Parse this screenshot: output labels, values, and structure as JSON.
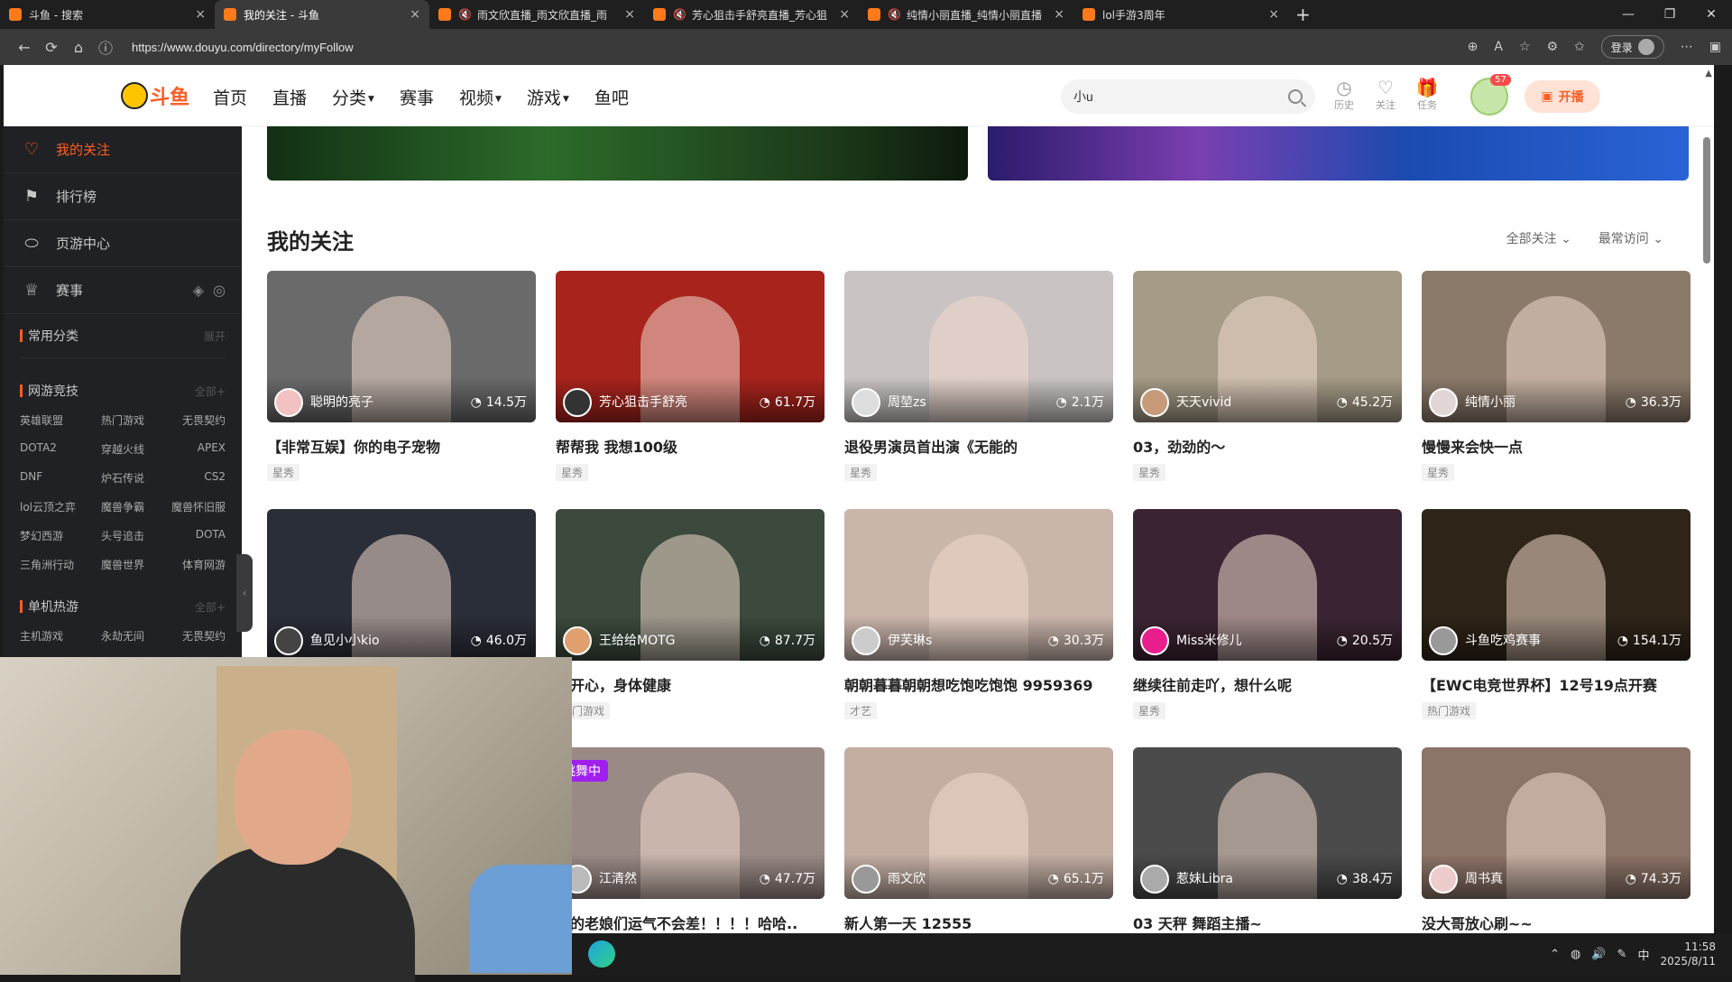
{
  "browser": {
    "tabs": [
      {
        "title": "斗鱼 - 搜索",
        "muted": false,
        "active": false
      },
      {
        "title": "我的关注 - 斗鱼",
        "muted": false,
        "active": true
      },
      {
        "title": "雨文欣直播_雨文欣直播_雨",
        "muted": true,
        "active": false
      },
      {
        "title": "芳心狙击手舒亮直播_芳心狙",
        "muted": true,
        "active": false
      },
      {
        "title": "纯情小丽直播_纯情小丽直播",
        "muted": true,
        "active": false
      },
      {
        "title": "lol手游3周年",
        "muted": false,
        "active": false
      }
    ],
    "url": "https://www.douyu.com/directory/myFollow",
    "login_label": "登录"
  },
  "header": {
    "logo_text": "斗鱼",
    "nav": [
      "首页",
      "直播",
      "分类",
      "赛事",
      "视频",
      "游戏",
      "鱼吧"
    ],
    "nav_dropdown": [
      false,
      false,
      true,
      false,
      true,
      true,
      false
    ],
    "search_value": "小u",
    "icons": [
      {
        "label": "历史",
        "glyph": "◷"
      },
      {
        "label": "关注",
        "glyph": "♡"
      },
      {
        "label": "任务",
        "glyph": "🎁"
      }
    ],
    "avatar_badge": "57",
    "kaibo_label": "开播"
  },
  "sidebar": {
    "items": [
      {
        "label": "我的关注",
        "icon": "heart-icon",
        "active": true
      },
      {
        "label": "排行榜",
        "icon": "rank-icon",
        "active": false
      },
      {
        "label": "页游中心",
        "icon": "mouse-icon",
        "active": false
      },
      {
        "label": "赛事",
        "icon": "trophy-icon",
        "active": false
      }
    ],
    "common": {
      "title": "常用分类",
      "more": "展开"
    },
    "wangyou": {
      "title": "网游竞技",
      "more": "全部",
      "items": [
        "英雄联盟",
        "热门游戏",
        "无畏契约",
        "DOTA2",
        "穿越火线",
        "APEX",
        "DNF",
        "炉石传说",
        "CS2",
        "lol云顶之弈",
        "魔兽争霸",
        "魔兽怀旧服",
        "梦幻西游",
        "头号追击",
        "DOTA",
        "三角洲行动",
        "魔兽世界",
        "体育网游"
      ]
    },
    "danji": {
      "title": "单机热游",
      "more": "全部",
      "items": [
        "主机游戏",
        "永劫无间",
        "无畏契约"
      ]
    }
  },
  "content": {
    "section_title": "我的关注",
    "filters": [
      "全部关注",
      "最常访问"
    ],
    "cards": [
      {
        "nick": "聪明的亮子",
        "heat": "14.5万",
        "title": "【非常互娱】你的电子宠物",
        "cat": "星秀",
        "bg": "#6a6a6a",
        "av": "#f2c1c1"
      },
      {
        "nick": "芳心狙击手舒亮",
        "heat": "61.7万",
        "title": "帮帮我 我想100级",
        "cat": "星秀",
        "bg": "#a8231c",
        "av": "#333"
      },
      {
        "nick": "周堃zs",
        "heat": "2.1万",
        "title": "退役男演员首出演《无能的",
        "cat": "星秀",
        "bg": "#c9c3c3",
        "av": "#ddd"
      },
      {
        "nick": "天天vivid",
        "heat": "45.2万",
        "title": "03，劲劲的～",
        "cat": "星秀",
        "bg": "#a59b86",
        "av": "#c79a7a"
      },
      {
        "nick": "纯情小丽",
        "heat": "36.3万",
        "title": "慢慢来会快一点",
        "cat": "星秀",
        "bg": "#8b7a6a",
        "av": "#e3d6d6"
      },
      {
        "nick": "鱼见小小kio",
        "heat": "46.0万",
        "title": "",
        "cat": "",
        "bg": "#2a2e38",
        "av": "#444"
      },
      {
        "nick": "王给给MOTG",
        "heat": "87.7万",
        "title": "天开心，身体健康",
        "cat": "热门游戏",
        "bg": "#3b4a3c",
        "av": "#e0a070"
      },
      {
        "nick": "伊芙琳s",
        "heat": "30.3万",
        "title": "朝朝暮暮朝朝想吃饱吃饱饱 9959369",
        "cat": "才艺",
        "bg": "#c9b5aa",
        "av": "#ccc"
      },
      {
        "nick": "Miss米修儿",
        "heat": "20.5万",
        "title": "继续往前走吖，想什么呢",
        "cat": "星秀",
        "bg": "#3a2433",
        "av": "#e91e8c"
      },
      {
        "nick": "斗鱼吃鸡赛事",
        "heat": "154.1万",
        "title": "【EWC电竞世界杯】12号19点开赛",
        "cat": "热门游戏",
        "bg": "#2e2418",
        "av": "#999"
      },
      {
        "nick": "",
        "heat": "",
        "title": "",
        "cat": "",
        "bg": "#555",
        "av": "#555"
      },
      {
        "nick": "江清然",
        "heat": "47.7万",
        "title": "笑的老娘们运气不会差！！！！哈哈..",
        "cat": "",
        "bg": "#9a8a86",
        "av": "#bbb",
        "tag": "跳舞中"
      },
      {
        "nick": "雨文欣",
        "heat": "65.1万",
        "title": "新人第一天 12555",
        "cat": "",
        "bg": "#c4aea2",
        "av": "#999"
      },
      {
        "nick": "惹妹Libra",
        "heat": "38.4万",
        "title": "03 天秤 舞蹈主播~",
        "cat": "",
        "bg": "#4b4b4b",
        "av": "#aaa"
      },
      {
        "nick": "周书真",
        "heat": "74.3万",
        "title": "没大哥放心刷~~",
        "cat": "",
        "bg": "#8d7468",
        "av": "#ecc"
      }
    ]
  },
  "taskbar": {
    "time": "11:58",
    "date": "2025/8/11",
    "ime": "中"
  }
}
